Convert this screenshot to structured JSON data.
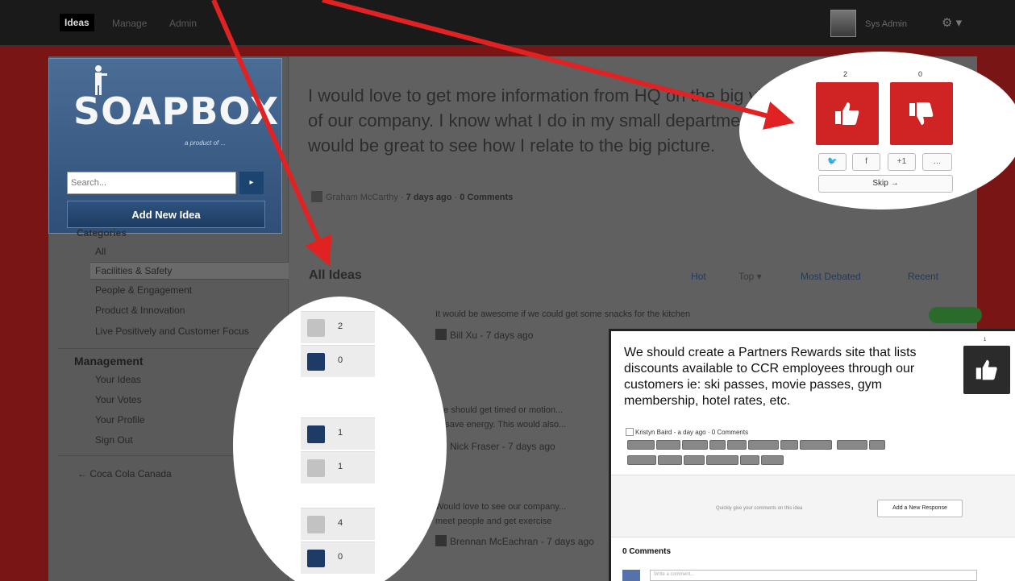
{
  "nav": {
    "tabs": [
      "Ideas",
      "Manage",
      "Admin"
    ],
    "user": "Sys Admin"
  },
  "brand": {
    "logo": "SOAPBOX",
    "tagline": "a product of ..."
  },
  "search": {
    "placeholder": "Search..."
  },
  "add_button": "Add New Idea",
  "categories": {
    "heading": "Categories",
    "items": [
      "All",
      "Facilities & Safety",
      "People & Engagement",
      "Product & Innovation",
      "Live Positively and Customer Focus"
    ]
  },
  "management": {
    "heading": "Management",
    "items": [
      "Your Ideas",
      "Your Votes",
      "Your Profile",
      "Sign Out"
    ],
    "org_link": "← Coca Cola Canada"
  },
  "featured": {
    "text": "I would love to get more information from HQ on the big vision of our company. I know what I do in my small department, but It would be great to see how I relate to the big picture.",
    "author": "Graham McCarthy",
    "time": "7 days ago",
    "comments": "0 Comments",
    "up_count": "2",
    "down_count": "0",
    "share": [
      "🐦",
      "f",
      "+1",
      "…"
    ],
    "skip": "Skip →"
  },
  "list": {
    "heading": "All Ideas",
    "sorts": [
      "Hot",
      "Top ▾",
      "Most Debated",
      "Recent"
    ],
    "ideas": [
      {
        "title": "It would be awesome if we could get some snacks for the kitchen",
        "author": "Bill Xu",
        "time": "7 days ago",
        "up": "2",
        "down": "0"
      },
      {
        "title": "We should get timed or motion...",
        "title2": "to save energy. This would also...",
        "author": "Nick Fraser",
        "time": "7 days ago",
        "up": "1",
        "down": "1"
      },
      {
        "title": "Would love to see our company...",
        "title2": "meet people and get exercise",
        "author": "Brennan McEachran",
        "time": "7 days ago",
        "up": "4",
        "down": "0"
      }
    ]
  },
  "popup": {
    "title": "We should create a Partners Rewards site that lists discounts available to CCR employees through our customers ie: ski passes, movie passes, gym membership, hotel rates, etc.",
    "author": "Kristyn Baird",
    "time": "a day ago",
    "comments": "0 Comments",
    "count": "1",
    "hint": "Quickly give your comments on this idea",
    "response_button": "Add a New Response",
    "comments_heading": "0 Comments",
    "comment_placeholder": "Write a comment..."
  },
  "colors": {
    "brand_red": "#d02424",
    "brand_blue": "#2f4f78",
    "nav_dark": "#1a1a1a"
  }
}
